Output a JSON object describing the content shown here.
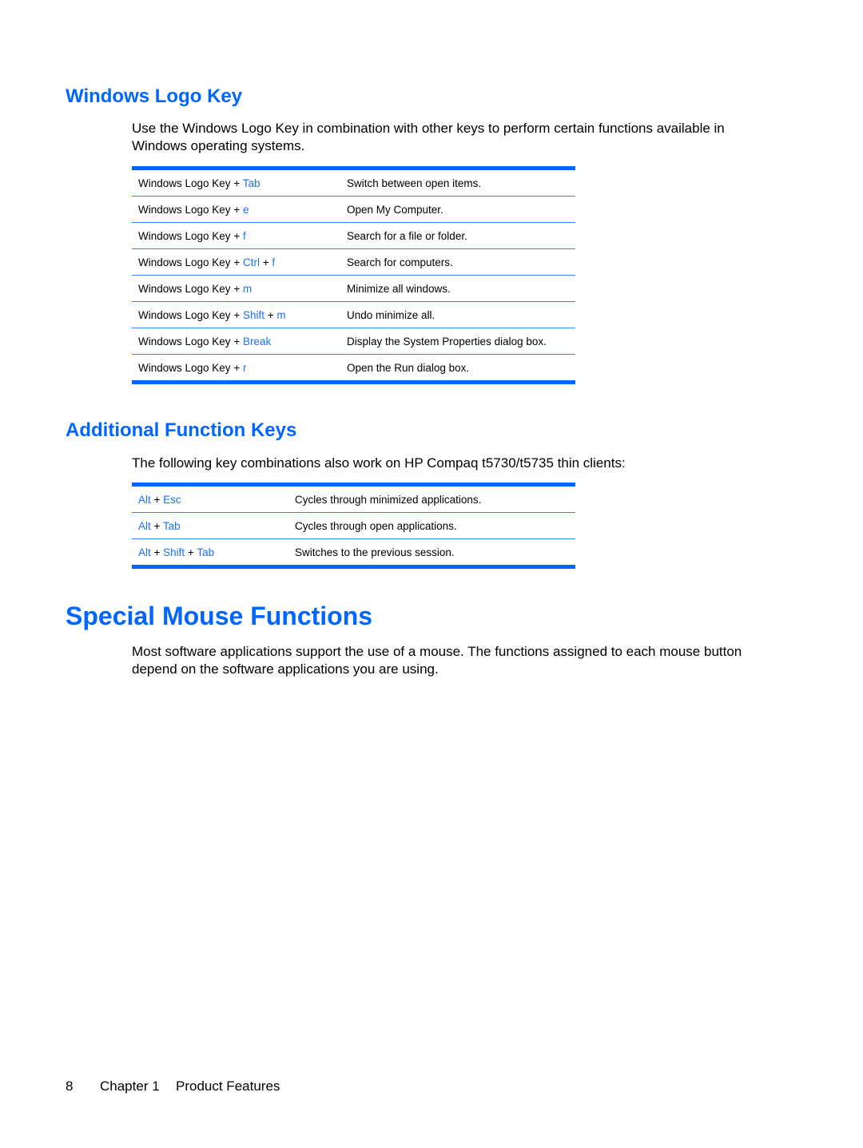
{
  "sections": {
    "windows_logo_key": {
      "title": "Windows Logo Key",
      "intro_line1": "Use the Windows Logo Key in combination with other keys to perform certain functions available in",
      "intro_line2": "Windows operating systems.",
      "rows": [
        {
          "keys": [
            {
              "t": "Windows Logo Key",
              "k": false
            },
            {
              "t": " + ",
              "k": false
            },
            {
              "t": "Tab",
              "k": true
            }
          ],
          "desc": "Switch between open items."
        },
        {
          "keys": [
            {
              "t": "Windows Logo Key",
              "k": false
            },
            {
              "t": " + ",
              "k": false
            },
            {
              "t": "e",
              "k": true
            }
          ],
          "desc": "Open My Computer."
        },
        {
          "keys": [
            {
              "t": "Windows Logo Key",
              "k": false
            },
            {
              "t": " + ",
              "k": false
            },
            {
              "t": "f",
              "k": true
            }
          ],
          "desc": "Search for a file or folder."
        },
        {
          "keys": [
            {
              "t": "Windows Logo Key",
              "k": false
            },
            {
              "t": " + ",
              "k": false
            },
            {
              "t": "Ctrl",
              "k": true
            },
            {
              "t": " + ",
              "k": false
            },
            {
              "t": "f",
              "k": true
            }
          ],
          "desc": "Search for computers."
        },
        {
          "keys": [
            {
              "t": "Windows Logo Key",
              "k": false
            },
            {
              "t": " + ",
              "k": false
            },
            {
              "t": "m",
              "k": true
            }
          ],
          "desc": "Minimize all windows."
        },
        {
          "keys": [
            {
              "t": "Windows Logo Key",
              "k": false
            },
            {
              "t": " + ",
              "k": false
            },
            {
              "t": "Shift",
              "k": true
            },
            {
              "t": " + ",
              "k": false
            },
            {
              "t": "m",
              "k": true
            }
          ],
          "desc": "Undo minimize all."
        },
        {
          "keys": [
            {
              "t": "Windows Logo Key",
              "k": false
            },
            {
              "t": " + ",
              "k": false
            },
            {
              "t": "Break",
              "k": true
            }
          ],
          "desc": "Display the System Properties dialog box."
        },
        {
          "keys": [
            {
              "t": "Windows Logo Key",
              "k": false
            },
            {
              "t": " + ",
              "k": false
            },
            {
              "t": "r",
              "k": true
            }
          ],
          "desc": "Open the Run dialog box."
        }
      ]
    },
    "additional_function_keys": {
      "title": "Additional Function Keys",
      "intro": "The following key combinations also work on HP Compaq t5730/t5735 thin clients:",
      "rows": [
        {
          "keys": [
            {
              "t": "Alt",
              "k": true
            },
            {
              "t": " + ",
              "k": false
            },
            {
              "t": "Esc",
              "k": true
            }
          ],
          "desc": "Cycles through minimized applications."
        },
        {
          "keys": [
            {
              "t": "Alt",
              "k": true
            },
            {
              "t": " + ",
              "k": false
            },
            {
              "t": "Tab",
              "k": true
            }
          ],
          "desc": "Cycles through open applications."
        },
        {
          "keys": [
            {
              "t": "Alt",
              "k": true
            },
            {
              "t": " + ",
              "k": false
            },
            {
              "t": "Shift",
              "k": true
            },
            {
              "t": " + ",
              "k": false
            },
            {
              "t": "Tab",
              "k": true
            }
          ],
          "desc": "Switches to the previous session."
        }
      ]
    },
    "special_mouse_functions": {
      "title": "Special Mouse Functions",
      "body_line1": "Most software applications support the use of a mouse. The functions assigned to each mouse button",
      "body_line2": "depend on the software applications you are using."
    }
  },
  "footer": {
    "page_number": "8",
    "chapter": "Chapter 1",
    "chapter_title": "Product Features"
  },
  "colors": {
    "accent": "#0066ff",
    "key_text": "#1a6fff"
  }
}
